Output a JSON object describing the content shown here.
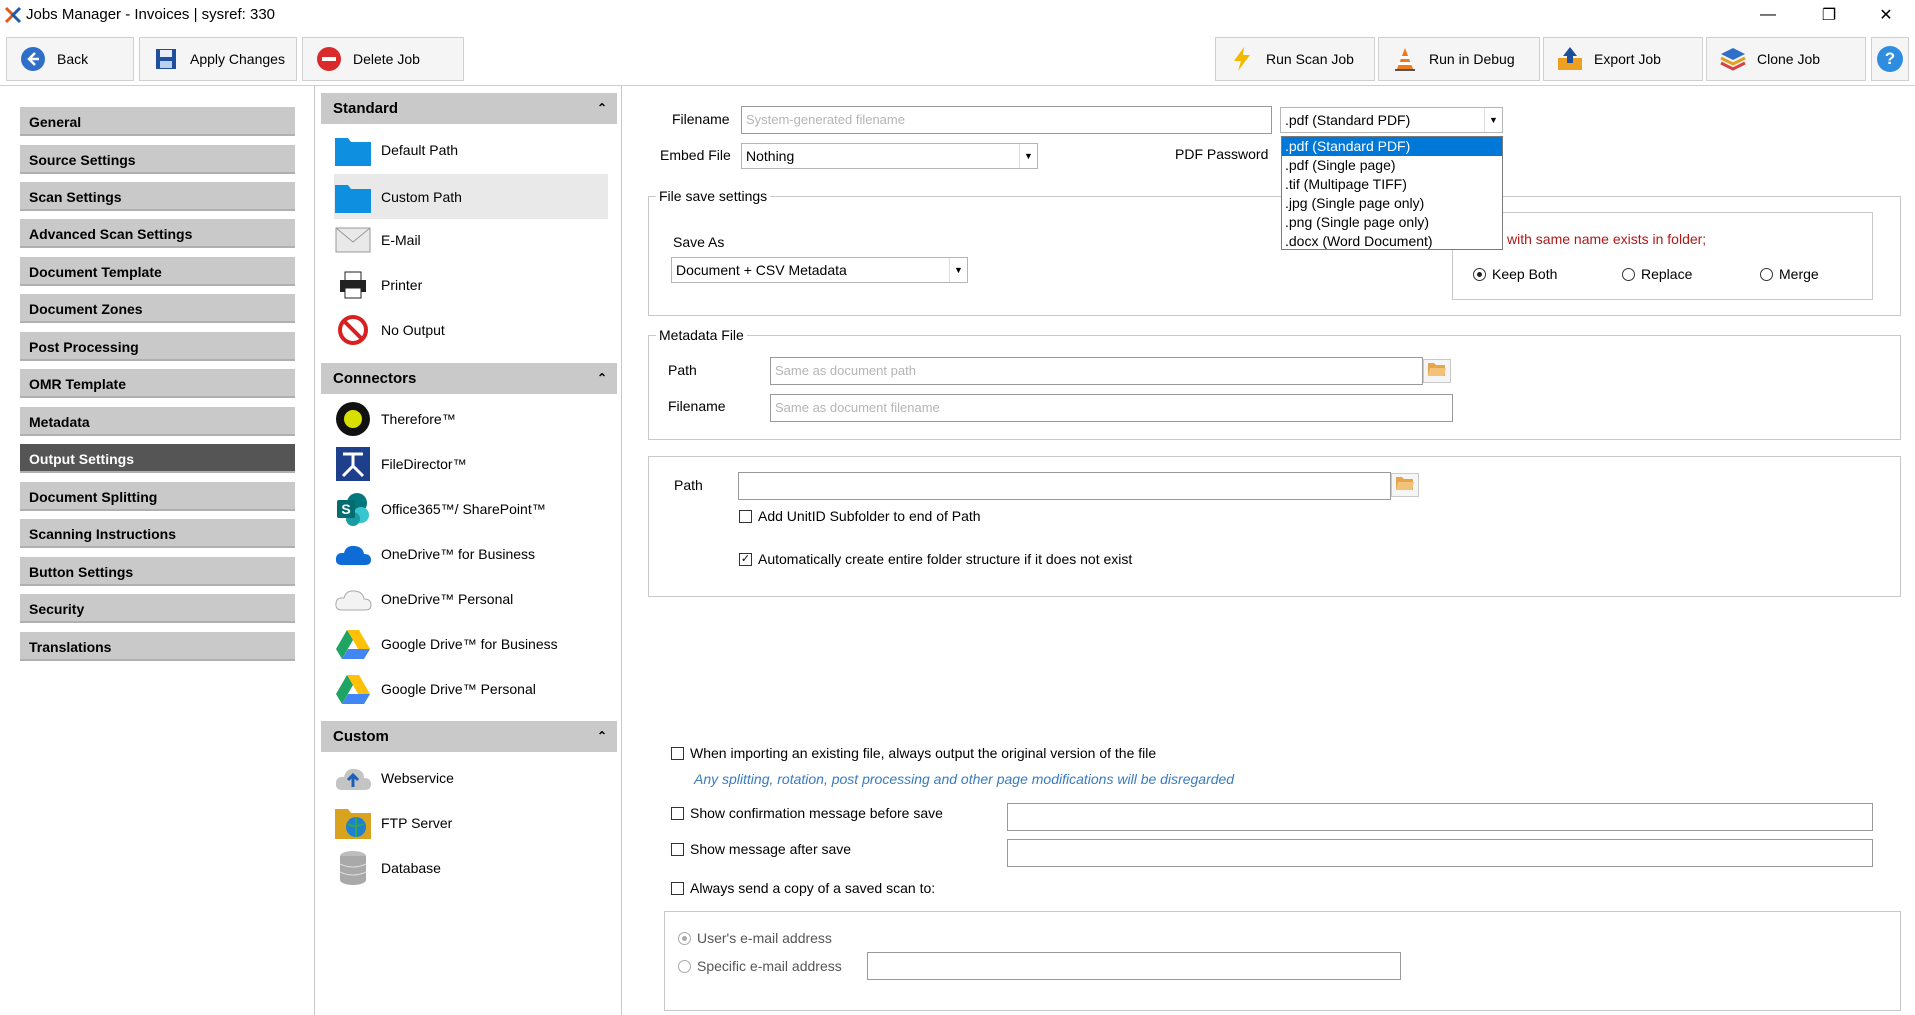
{
  "window": {
    "title": "Jobs Manager - Invoices  |  sysref: 330",
    "minimize": "—",
    "restore": "❐",
    "close": "✕"
  },
  "toolbar": {
    "back": "Back",
    "apply": "Apply Changes",
    "delete": "Delete Job",
    "run_scan": "Run Scan Job",
    "run_debug": "Run in Debug",
    "export": "Export Job",
    "clone": "Clone Job",
    "help": "?"
  },
  "nav": {
    "items": [
      "General",
      "Source Settings",
      "Scan Settings",
      "Advanced Scan Settings",
      "Document Template",
      "Document Zones",
      "Post Processing",
      "OMR Template",
      "Metadata",
      "Output Settings",
      "Document Splitting",
      "Scanning Instructions",
      "Button Settings",
      "Security",
      "Translations"
    ],
    "active": "Output Settings"
  },
  "panel": {
    "standard": {
      "title": "Standard",
      "items": [
        "Default Path",
        "Custom Path",
        "E-Mail",
        "Printer",
        "No Output"
      ]
    },
    "connectors": {
      "title": "Connectors",
      "items": [
        "Therefore™",
        "FileDirector™",
        "Office365™/ SharePoint™",
        "OneDrive™ for Business",
        "OneDrive™ Personal",
        "Google Drive™ for Business",
        "Google Drive™ Personal"
      ]
    },
    "custom": {
      "title": "Custom",
      "items": [
        "Webservice",
        "FTP Server",
        "Database"
      ]
    }
  },
  "content": {
    "filename_label": "Filename",
    "filename_placeholder": "System-generated filename",
    "format_selected": ".pdf (Standard PDF)",
    "format_options": [
      ".pdf (Standard PDF)",
      ".pdf (Single page)",
      ".tif (Multipage TIFF)",
      ".jpg (Single page only)",
      ".png (Single page only)",
      ".docx (Word Document)"
    ],
    "embed_label": "Embed File",
    "embed_value": "Nothing",
    "pdf_password_label": "PDF Password",
    "file_save_title": "File save settings",
    "save_as_label": "Save As",
    "save_as_value": "Document + CSV Metadata",
    "exists_text": "with same name exists in folder;",
    "keep_both": "Keep Both",
    "replace": "Replace",
    "merge": "Merge",
    "metadata_title": "Metadata File",
    "meta_path_label": "Path",
    "meta_path_placeholder": "Same as document path",
    "meta_filename_label": "Filename",
    "meta_filename_placeholder": "Same as document filename",
    "path_label": "Path",
    "add_unitid": "Add UnitID Subfolder to end of Path",
    "auto_create": "Automatically create entire folder structure if it does not exist",
    "import_original": "When importing an existing file, always output the original version of the file",
    "import_note": "Any splitting, rotation, post processing and other page modifications will be disregarded",
    "confirm_before": "Show confirmation message before save",
    "msg_after": "Show message after save",
    "send_copy": "Always send a copy of a saved scan to:",
    "user_email": "User's e-mail address",
    "specific_email": "Specific e-mail address"
  },
  "colors": {
    "accent": "#0078d7",
    "nav_bg": "#c9c9c9",
    "nav_active": "#555555",
    "note_blue": "#3a7bbf",
    "warn_red": "#b01818"
  }
}
